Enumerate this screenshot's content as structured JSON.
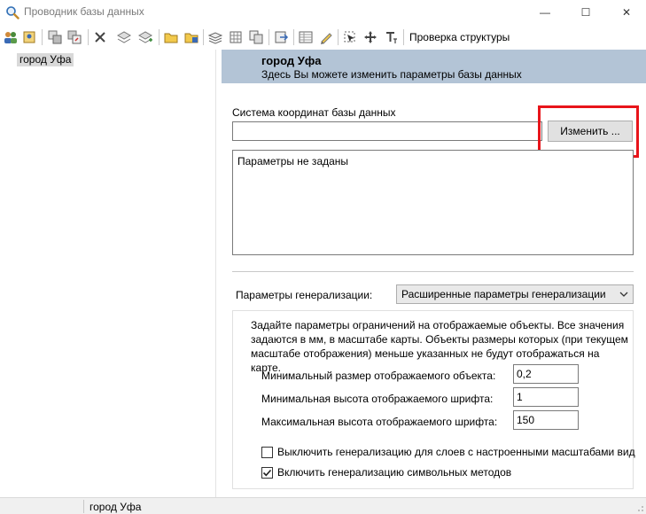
{
  "window": {
    "title": "Проводник базы данных",
    "min_glyph": "—",
    "max_glyph": "☐",
    "close_glyph": "✕",
    "app_icon": "magnifier-database-icon"
  },
  "toolbar": {
    "check_structure_label": "Проверка структуры",
    "icons": [
      "users-icon",
      "user-properties-icon",
      "copy-layer-icon",
      "paste-layer-icon",
      "delete-icon",
      "layers-icon",
      "layers-add-icon",
      "folder-open-icon",
      "folder-add-icon",
      "stack-icon",
      "grid-icon",
      "table-copy-icon",
      "export-icon",
      "table-icon",
      "pencil-icon",
      "select-tool-icon",
      "move-tool-icon",
      "text-tool-icon"
    ]
  },
  "tree": {
    "items": [
      {
        "label": "город Уфа"
      }
    ]
  },
  "header": {
    "title": "город Уфа",
    "subtitle": "Здесь Вы можете изменить параметры базы данных"
  },
  "coords": {
    "label": "Система координат базы данных",
    "value": "",
    "change_button": "Изменить ...",
    "params_text": "Параметры не заданы"
  },
  "generalization": {
    "label": "Параметры генерализации:",
    "selected": "Расширенные параметры генерализации",
    "description": "Задайте параметры ограничений на отображаемые объекты. Все значения задаются в мм, в масштабе карты. Объекты размеры которых (при текущем масштабе отображения) меньше указанных не будут отображаться на карте.",
    "fields": [
      {
        "label": "Минимальный размер отображаемого объекта:",
        "value": "0,2"
      },
      {
        "label": "Минимальная высота отображаемого шрифта:",
        "value": "1"
      },
      {
        "label": "Максимальная высота отображаемого шрифта:",
        "value": "150"
      }
    ],
    "checkboxes": [
      {
        "label": "Выключить генерализацию для слоев с настроенными масштабами вид",
        "checked": false
      },
      {
        "label": "Включить генерализацию символьных методов",
        "checked": true
      }
    ]
  },
  "status": {
    "text": "город Уфа"
  },
  "colors": {
    "header_band": "#b3c4d6",
    "highlight": "#e8141a"
  }
}
